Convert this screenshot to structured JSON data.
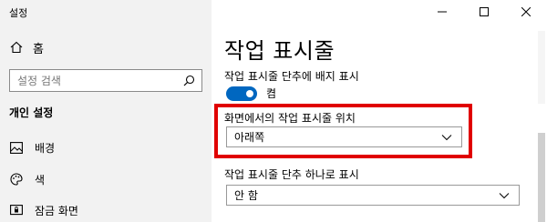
{
  "window": {
    "title": "설정"
  },
  "sidebar": {
    "home_label": "홈",
    "search_placeholder": "설정 검색",
    "section_title": "개인 설정",
    "items": [
      {
        "label": "배경",
        "icon": "image-icon"
      },
      {
        "label": "색",
        "icon": "palette-icon"
      },
      {
        "label": "잠금 화면",
        "icon": "lock-screen-icon"
      }
    ]
  },
  "main": {
    "page_title": "작업 표시줄",
    "badge_setting": {
      "label": "작업 표시줄 단추에 배지 표시",
      "toggle_state": "켬",
      "on": true
    },
    "location_setting": {
      "label": "화면에서의 작업 표시줄 위치",
      "value": "아래쪽"
    },
    "combine_setting": {
      "label": "작업 표시줄 단추 하나로 표시",
      "value": "안 함"
    }
  },
  "colors": {
    "accent": "#0067c0",
    "highlight": "#e00000",
    "sidebar_bg": "#f2f2f2"
  }
}
